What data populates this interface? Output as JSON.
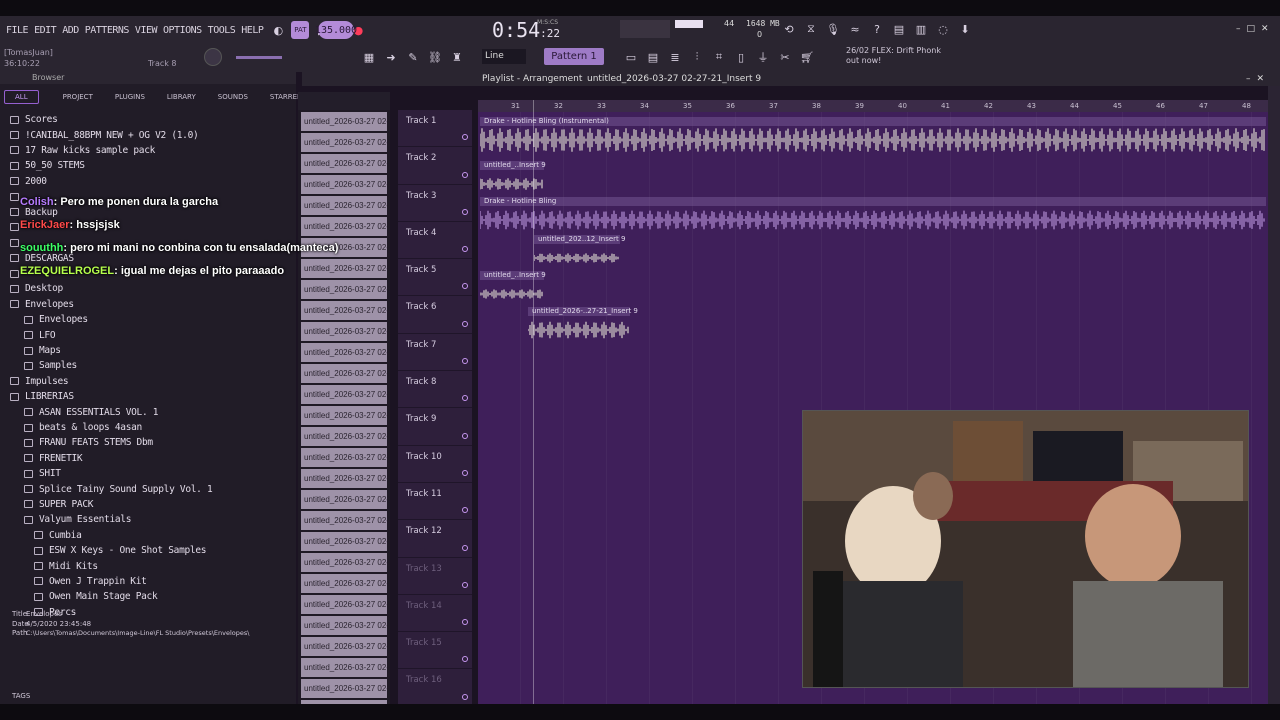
{
  "menu": [
    "FILE",
    "EDIT",
    "ADD",
    "PATTERNS",
    "VIEW",
    "OPTIONS",
    "TOOLS",
    "HELP"
  ],
  "hint": {
    "user": "[TomasJuan]",
    "time": "36:10:22",
    "track": "Track 8"
  },
  "transport": {
    "tempo": "135.000",
    "time": "0:54",
    "time_sub": ":22",
    "time_label": "M:S:CS"
  },
  "perf": {
    "cpu": "44",
    "memory": "1648 MB",
    "voices": "0"
  },
  "snap": "Line",
  "pattern": "Pattern 1",
  "news": {
    "date": "26/02",
    "line1": "FLEX: Drift Phonk",
    "line2": "out now!"
  },
  "browser": {
    "title": "Browser",
    "tabs": [
      "ALL",
      "PROJECT",
      "PLUGINS",
      "LIBRARY",
      "SOUNDS",
      "STARRED"
    ],
    "items": [
      {
        "label": "Scores",
        "level": 0
      },
      {
        "label": "!CANIBAL_88BPM NEW + OG V2 (1.0)",
        "level": 0
      },
      {
        "label": "17 Raw kicks sample pack",
        "level": 0
      },
      {
        "label": "50_50 STEMS",
        "level": 0
      },
      {
        "label": "2000",
        "level": 0
      },
      {
        "label": "",
        "level": 0
      },
      {
        "label": "Backup",
        "level": 0
      },
      {
        "label": "",
        "level": 0
      },
      {
        "label": "",
        "level": 0
      },
      {
        "label": "DESCARGAS",
        "level": 0
      },
      {
        "label": "",
        "level": 0
      },
      {
        "label": "Desktop",
        "level": 0
      },
      {
        "label": "Envelopes",
        "level": 0
      },
      {
        "label": "Envelopes",
        "level": 1
      },
      {
        "label": "LFO",
        "level": 1
      },
      {
        "label": "Maps",
        "level": 1
      },
      {
        "label": "Samples",
        "level": 1
      },
      {
        "label": "Impulses",
        "level": 0
      },
      {
        "label": "LIBRERIAS",
        "level": 0
      },
      {
        "label": "ASAN ESSENTIALS VOL. 1",
        "level": 1
      },
      {
        "label": "beats & loops 4asan",
        "level": 1
      },
      {
        "label": "FRANU FEATS STEMS Dbm",
        "level": 1
      },
      {
        "label": "FRENETIK",
        "level": 1
      },
      {
        "label": "SHIT",
        "level": 1
      },
      {
        "label": "Splice Tainy Sound Supply Vol. 1",
        "level": 1
      },
      {
        "label": "SUPER PACK",
        "level": 1
      },
      {
        "label": "Valyum Essentials",
        "level": 1
      },
      {
        "label": "Cumbia",
        "level": 2
      },
      {
        "label": "ESW X Keys - One Shot Samples",
        "level": 2
      },
      {
        "label": "Midi Kits",
        "level": 2
      },
      {
        "label": "Owen J Trappin Kit",
        "level": 2
      },
      {
        "label": "Owen Main Stage Pack",
        "level": 2
      },
      {
        "label": "Percs",
        "level": 2
      }
    ],
    "info": {
      "title_k": "Title",
      "title_v": "Envelopes",
      "date_k": "Date",
      "date_v": "4/5/2020 23:45:48",
      "path_k": "Path",
      "path_v": "C:\\Users\\Tomas\\Documents\\Image-Line\\FL Studio\\Presets\\Envelopes\\"
    },
    "tags": "TAGS"
  },
  "chat": [
    {
      "user": "Colish",
      "msg": ": Pero me ponen dura la garcha"
    },
    {
      "user": "ErickJaer",
      "msg": ": hssjsjsk"
    },
    {
      "user": "souuthh",
      "msg": ": pero mi mani no conbina con tu ensalada(manteca)"
    },
    {
      "user": "EZEQUIELROGEL",
      "msg": ": igual me dejas el pito paraaado"
    }
  ],
  "playlist": {
    "title": "Playlist - Arrangement",
    "file": "untitled_2026-03-27 02-27-21_Insert 9",
    "clip_label": "untitled_2026-03-27 02-...",
    "ruler": [
      "31",
      "32",
      "33",
      "34",
      "35",
      "36",
      "37",
      "38",
      "39",
      "40",
      "41",
      "42",
      "43",
      "44",
      "45",
      "46",
      "47",
      "48"
    ],
    "tracks": [
      "Track 1",
      "Track 2",
      "Track 3",
      "Track 4",
      "Track 5",
      "Track 6",
      "Track 7",
      "Track 8",
      "Track 9",
      "Track 10",
      "Track 11",
      "Track 12",
      "Track 13",
      "Track 14",
      "Track 15",
      "Track 16"
    ],
    "audio": [
      {
        "label": "Drake - Hotline Bling (Instrumental)"
      },
      {
        "label": "untitled_..Insert 9"
      },
      {
        "label": "Drake - Hotline Bling"
      },
      {
        "label": "untitled_202..12_Insert 9"
      },
      {
        "label": "untitled_..Insert 9"
      },
      {
        "label": "untitled_2026-..27-21_Insert 9"
      }
    ]
  }
}
